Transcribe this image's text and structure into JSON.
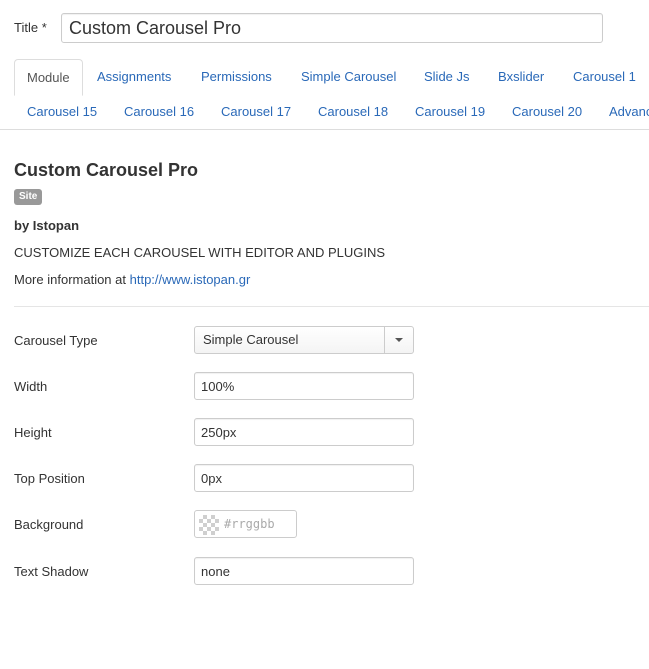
{
  "title_field": {
    "label": "Title *",
    "value": "Custom Carousel Pro"
  },
  "tabs_row1": [
    {
      "label": "Module",
      "active": true
    },
    {
      "label": "Assignments"
    },
    {
      "label": "Permissions"
    },
    {
      "label": "Simple Carousel"
    },
    {
      "label": "Slide Js"
    },
    {
      "label": "Bxslider"
    },
    {
      "label": "Carousel 1"
    }
  ],
  "tabs_row2": [
    {
      "label": "Carousel 15"
    },
    {
      "label": "Carousel 16"
    },
    {
      "label": "Carousel 17"
    },
    {
      "label": "Carousel 18"
    },
    {
      "label": "Carousel 19"
    },
    {
      "label": "Carousel 20"
    },
    {
      "label": "Advanc"
    }
  ],
  "module": {
    "name": "Custom Carousel Pro",
    "badge": "Site",
    "author": "by Istopan",
    "description": "CUSTOMIZE EACH CAROUSEL WITH EDITOR AND PLUGINS",
    "more_info_prefix": "More information at",
    "more_info_link": "http://www.istopan.gr"
  },
  "fields": {
    "carousel_type": {
      "label": "Carousel Type",
      "value": "Simple Carousel"
    },
    "width": {
      "label": "Width",
      "value": "100%"
    },
    "height": {
      "label": "Height",
      "value": "250px"
    },
    "top_position": {
      "label": "Top Position",
      "value": "0px"
    },
    "background": {
      "label": "Background",
      "placeholder": "#rrggbb"
    },
    "text_shadow": {
      "label": "Text Shadow",
      "value": "none"
    }
  },
  "colors": {
    "link": "#2a69b8",
    "badge": "#999999",
    "border": "#cccccc"
  }
}
